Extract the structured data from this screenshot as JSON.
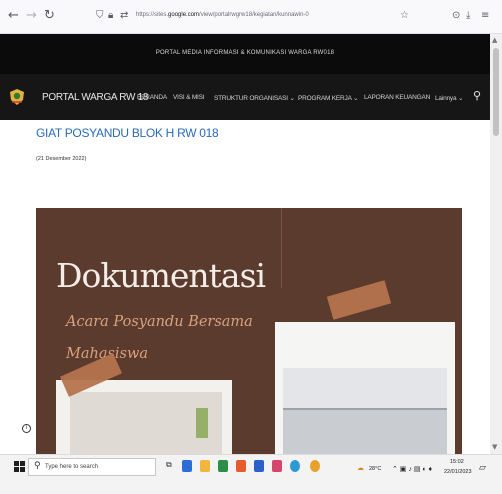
{
  "browser": {
    "back_icon": "arrow-left-icon",
    "forward_icon": "arrow-right-icon",
    "reload_icon": "reload-icon",
    "url_prefix": "https://sites.",
    "url_host": "google.com",
    "url_rest": "/view/portalrwgrw18/kegiatan/kunnawin-0",
    "bookmark_icon": "star-icon",
    "pocket_icon": "pocket-icon",
    "download_icon": "download-icon",
    "menu_icon": "hamburger-menu-icon"
  },
  "site": {
    "top_banner": "PORTAL MEDIA INFORMASI & KOMUNIKASI WARGA RW018",
    "name": "PORTAL WARGA RW 18",
    "nav": [
      "BERANDA",
      "VISI & MISI",
      "STRUKTUR ORGANISASI ⌄",
      "PROGRAM KERJA ⌄",
      "LAPORAN KEUANGAN",
      "Lainnya ⌄"
    ],
    "search_icon": "search-icon"
  },
  "page": {
    "title": "GIAT POSYANDU BLOK H RW 018",
    "date": "(21 Desember 2022)",
    "poster": {
      "heading": "Dokumentasi",
      "subtitle_line1": "Acara Posyandu Bersama",
      "subtitle_line2": "Mahasiswa"
    }
  },
  "taskbar": {
    "search_placeholder": "Type here to search",
    "weather": "28°C",
    "time": "15:02",
    "date": "22/01/2023"
  },
  "colors": {
    "nav_bg": "#161616",
    "title_blue": "#2a6bb8",
    "poster_brown": "#5b3b2d",
    "poster_accent": "#d9a27e",
    "tape": "#b5734d"
  }
}
